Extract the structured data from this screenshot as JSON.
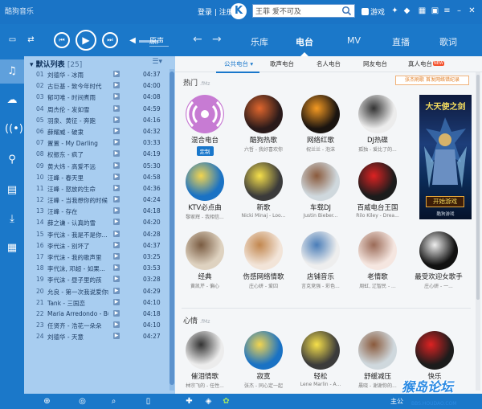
{
  "app": {
    "title": "酷狗音乐"
  },
  "titlebar": {
    "login": "登录 | 注册",
    "logo": "K",
    "search_value": "王菲 爱不可及",
    "game_label": "游戏"
  },
  "main_tabs": [
    {
      "label": "乐库",
      "active": false
    },
    {
      "label": "电台",
      "active": true
    },
    {
      "label": "MV",
      "active": false
    },
    {
      "label": "直播",
      "active": false
    },
    {
      "label": "歌词",
      "active": false
    }
  ],
  "player": {
    "listen_mode": "原声"
  },
  "playlist": {
    "title": "默认列表",
    "count": "[25]",
    "songs": [
      {
        "num": "01",
        "name": "刘德华 - 冰雨",
        "dur": "04:37"
      },
      {
        "num": "02",
        "name": "古巨基 - 致今年时代",
        "dur": "04:00"
      },
      {
        "num": "03",
        "name": "郁可唯 - 时间煮雨",
        "dur": "04:08"
      },
      {
        "num": "04",
        "name": "周杰伦 - 发如雪",
        "dur": "04:59"
      },
      {
        "num": "05",
        "name": "羽泉、黄征 - 奔跑",
        "dur": "04:16"
      },
      {
        "num": "06",
        "name": "薛耀威 - 破隶",
        "dur": "04:32"
      },
      {
        "num": "07",
        "name": "置置 - My Darling",
        "dur": "03:33"
      },
      {
        "num": "08",
        "name": "权振东 - 疯了",
        "dur": "04:19"
      },
      {
        "num": "09",
        "name": "黄大炜 - 高爱不远",
        "dur": "05:30"
      },
      {
        "num": "10",
        "name": "汪峰 - 春天里",
        "dur": "04:58"
      },
      {
        "num": "11",
        "name": "汪峰 - 怒放的生命",
        "dur": "04:36"
      },
      {
        "num": "12",
        "name": "汪峰 - 当我想你的时候",
        "dur": "04:24"
      },
      {
        "num": "13",
        "name": "汪峰 - 存在",
        "dur": "04:18"
      },
      {
        "num": "14",
        "name": "薛之谦 - 认真的雪",
        "dur": "04:20"
      },
      {
        "num": "15",
        "name": "李代沫 - 我是不是你...",
        "dur": "04:28"
      },
      {
        "num": "16",
        "name": "李代沫 - 别坏了",
        "dur": "04:37"
      },
      {
        "num": "17",
        "name": "李代沫 - 我的歌声里",
        "dur": "03:25"
      },
      {
        "num": "18",
        "name": "李代沫, 邓超 - 如果...",
        "dur": "03:53"
      },
      {
        "num": "19",
        "name": "李代沫 - 昼子里的孩",
        "dur": "03:28"
      },
      {
        "num": "20",
        "name": "允良 - 第一次我说爱你的时候",
        "dur": "04:29"
      },
      {
        "num": "21",
        "name": "Tank - 三国恋",
        "dur": "04:10"
      },
      {
        "num": "22",
        "name": "Maria Arredondo - Bu...",
        "dur": "04:18"
      },
      {
        "num": "23",
        "name": "任贤齐 - 浩花一朵朵",
        "dur": "04:10"
      },
      {
        "num": "24",
        "name": "刘德华 - 天意",
        "dur": "04:27"
      }
    ]
  },
  "subtabs": [
    {
      "label": "公共电台",
      "active": true,
      "hot": false
    },
    {
      "label": "歌声电台",
      "active": false,
      "hot": false
    },
    {
      "label": "名人电台",
      "active": false,
      "hot": false
    },
    {
      "label": "网友电台",
      "active": false,
      "hot": false
    },
    {
      "label": "真人电台",
      "active": false,
      "hot": true,
      "badge": "NEW"
    }
  ],
  "sections": {
    "hot": {
      "title": "热门",
      "sub": ".fMz"
    },
    "mood": {
      "title": "心情",
      "sub": ".fMz"
    }
  },
  "promo": "张杰刷歌 首发网络错纪录",
  "hot_stations": [
    {
      "title": "混合电台",
      "sub": "",
      "custom": "定制"
    },
    {
      "title": "酷狗热歌",
      "sub": "六哲 - 我好喜欢你"
    },
    {
      "title": "网络红歌",
      "sub": "祝兰兰 - 泡沫"
    },
    {
      "title": "DJ热碟",
      "sub": "孤独 - 爱比了的..."
    },
    {
      "title": "KTV必点曲",
      "sub": "黎家辉 - 我相信..."
    },
    {
      "title": "新歌",
      "sub": "Nicki Minaj - Loo..."
    },
    {
      "title": "车载DJ",
      "sub": "Justin Bieber..."
    },
    {
      "title": "百威电台王国",
      "sub": "Rilo Kiley - Drea..."
    },
    {
      "title": "经典",
      "sub": "黄凯芹 - 偏心"
    },
    {
      "title": "伤感网络情歌",
      "sub": "庄心妍 - 爱囚"
    },
    {
      "title": "店铺音乐",
      "sub": "言克竞强 - 彩色..."
    },
    {
      "title": "老情歌",
      "sub": "周虹, 辽智民 - ..."
    },
    {
      "title": "最受欢迎女歌手",
      "sub": "庄心妍 - 一..."
    }
  ],
  "ad": {
    "title": "大天使之剑",
    "button": "开始游戏",
    "footer": "酷狗游戏"
  },
  "mood_stations": [
    {
      "title": "催泪情歌",
      "sub": "林宗飞的 - 任性..."
    },
    {
      "title": "寂寞",
      "sub": "张杰 - 同心定一起"
    },
    {
      "title": "轻松",
      "sub": "Lene Marlin - A..."
    },
    {
      "title": "舒缓减压",
      "sub": "晨晓 - 谢谢你的..."
    },
    {
      "title": "快乐",
      "sub": ""
    }
  ],
  "bottom": {
    "right_text": "主公"
  },
  "watermark": {
    "main": "猴岛论坛",
    "sub": "BBS.HOUDAO.COM"
  }
}
